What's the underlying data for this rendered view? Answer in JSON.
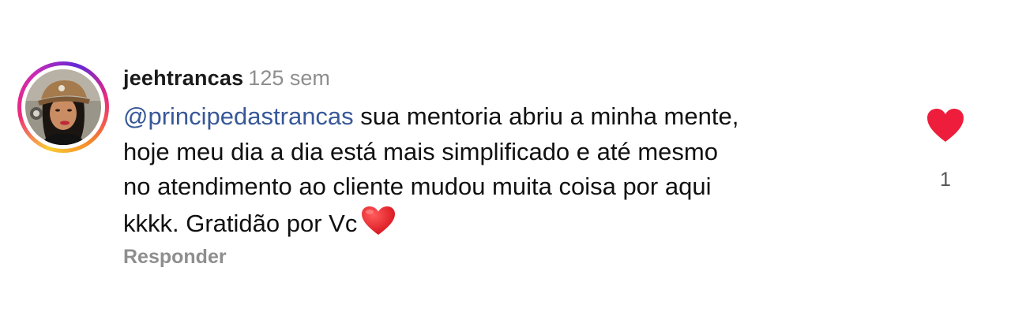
{
  "comment": {
    "username": "jeehtrancas",
    "timestamp": "125 sem",
    "mention": "@principedastrancas",
    "text_line1": " sua mentoria abriu a minha mente,",
    "text_line2": "hoje meu dia a dia está mais simplificado e até mesmo",
    "text_line3": "no atendimento ao cliente mudou muita coisa por aqui",
    "text_line4": "kkkk. Gratidão por Vc",
    "inline_emoji": "red-heart-emoji",
    "reply_label": "Responder",
    "like_count": "1",
    "liked": true
  },
  "colors": {
    "like_heart": "#ee1d3c",
    "mention": "#385898",
    "secondary_text": "#8e8e8e"
  },
  "icons": {
    "like": "heart-icon",
    "avatar": "profile-photo"
  }
}
